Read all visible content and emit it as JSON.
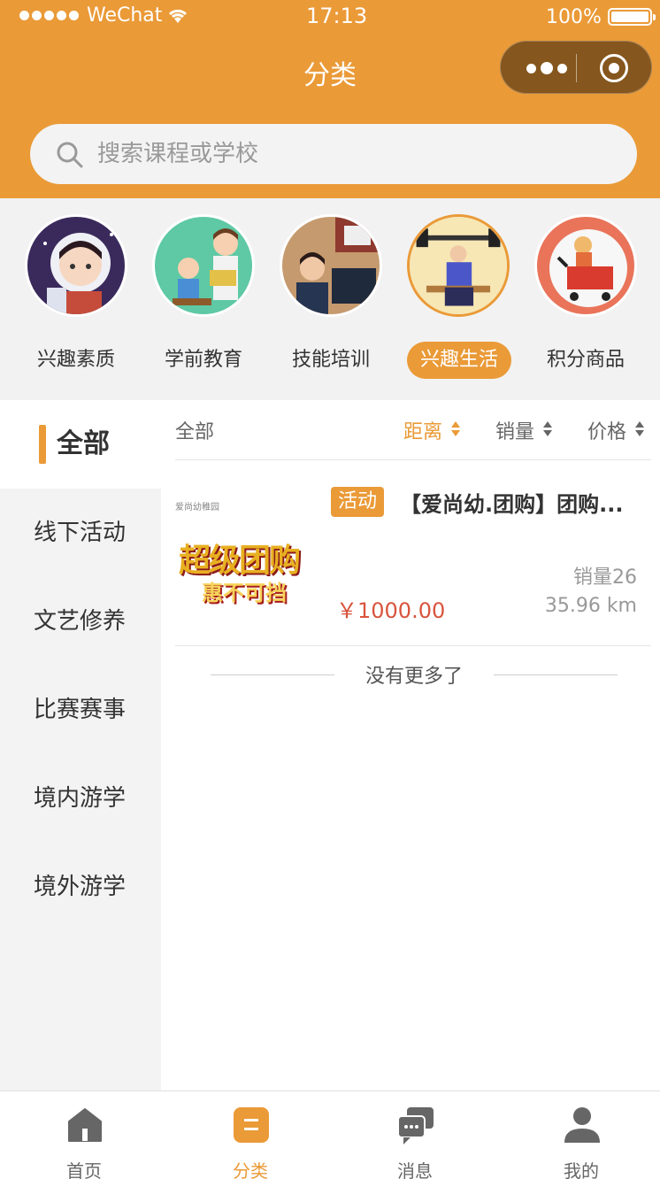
{
  "status_bar": {
    "carrier": "WeChat",
    "time": "17:13",
    "battery": "100%"
  },
  "nav": {
    "title": "分类"
  },
  "search": {
    "placeholder": "搜索课程或学校"
  },
  "categories": [
    {
      "label": "兴趣素质",
      "icon": "astronaut-kid-avatar",
      "active": false
    },
    {
      "label": "学前教育",
      "icon": "teacher-student-avatar",
      "active": false
    },
    {
      "label": "技能培训",
      "icon": "office-worker-avatar",
      "active": false
    },
    {
      "label": "兴趣生活",
      "icon": "weightlifter-avatar",
      "active": true
    },
    {
      "label": "积分商品",
      "icon": "shopping-cart-avatar",
      "active": false
    }
  ],
  "sidebar": {
    "items": [
      {
        "label": "全部",
        "active": true
      },
      {
        "label": "线下活动",
        "active": false
      },
      {
        "label": "文艺修养",
        "active": false
      },
      {
        "label": "比赛赛事",
        "active": false
      },
      {
        "label": "境内游学",
        "active": false
      },
      {
        "label": "境外游学",
        "active": false
      }
    ]
  },
  "sort": {
    "all": "全部",
    "options": [
      {
        "label": "距离",
        "active": true
      },
      {
        "label": "销量",
        "active": false
      },
      {
        "label": "价格",
        "active": false
      }
    ]
  },
  "products": [
    {
      "tag": "活动",
      "title": "【爱尚幼.团购】团购...",
      "sales": "销量26",
      "price": "￥1000.00",
      "distance": "35.96 km",
      "thumb_brand": "爱尚幼稚园",
      "thumb_line1": "超级团购",
      "thumb_line2": "惠不可挡"
    }
  ],
  "list_footer": "没有更多了",
  "tabbar": {
    "items": [
      {
        "label": "首页",
        "icon": "home-icon",
        "active": false
      },
      {
        "label": "分类",
        "icon": "category-icon",
        "active": true
      },
      {
        "label": "消息",
        "icon": "message-icon",
        "active": false
      },
      {
        "label": "我的",
        "icon": "user-icon",
        "active": false
      }
    ]
  },
  "colors": {
    "accent": "#ea9a37",
    "price": "#d8543c",
    "sidebar_bg": "#f4f3f4"
  }
}
